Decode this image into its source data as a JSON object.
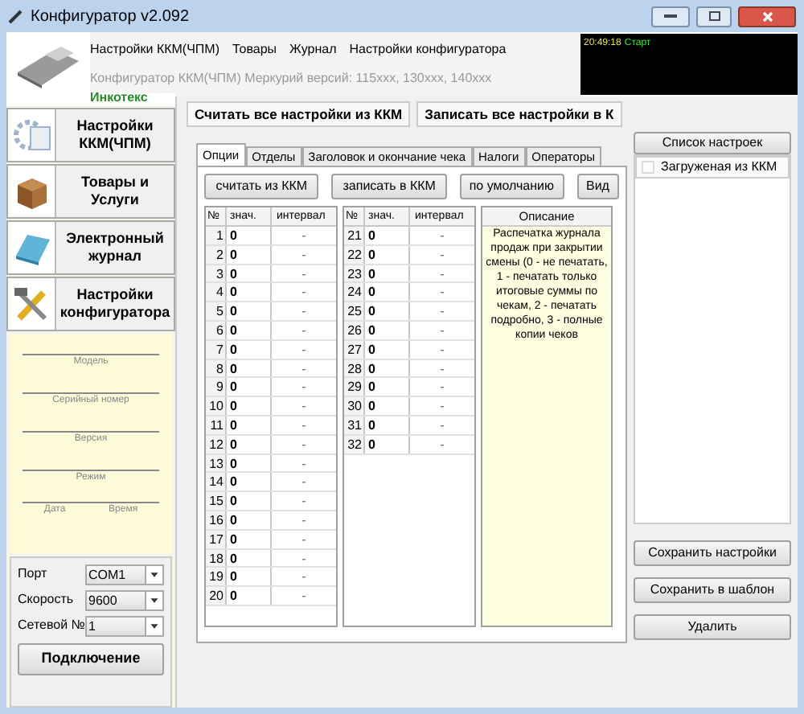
{
  "window": {
    "title": "Конфигуратор v2.092"
  },
  "header": {
    "menu": [
      "Настройки ККМ(ЧПМ)",
      "Товары",
      "Журнал",
      "Настройки конфигуратора"
    ],
    "subtitle": "Конфигуратор ККМ(ЧПМ) Меркурий версий: 115ххх, 130ххх, 140ххх",
    "brand": "Инкотекс",
    "log": [
      {
        "time": "20:49:18",
        "text": "Старт"
      }
    ]
  },
  "sidebar": {
    "nav": [
      {
        "label": "Настройки ККМ(ЧПМ)",
        "kind": "settings"
      },
      {
        "label": "Товары и Услуги",
        "kind": "goods"
      },
      {
        "label": "Электронный журнал",
        "kind": "journal"
      },
      {
        "label": "Настройки конфигуратора",
        "kind": "config"
      }
    ],
    "info_fields": [
      "Модель",
      "Серийный номер",
      "Версия",
      "Режим"
    ],
    "date_label": "Дата",
    "time_label": "Время",
    "connection": {
      "fields": [
        {
          "label": "Порт",
          "value": "COM1"
        },
        {
          "label": "Скорость",
          "value": "9600"
        },
        {
          "label": "Сетевой №",
          "value": "1"
        }
      ],
      "button": "Подключение"
    }
  },
  "toolbar": [
    "Считать все настройки из ККМ",
    "Записать все настройки в К"
  ],
  "tabs": [
    {
      "label": "Опции",
      "selected": true
    },
    {
      "label": "Отделы",
      "selected": false
    },
    {
      "label": "Заголовок и окончание чека",
      "selected": false
    },
    {
      "label": "Налоги",
      "selected": false
    },
    {
      "label": "Операторы",
      "selected": false
    }
  ],
  "actions": [
    "считать из ККМ",
    "записать в ККМ",
    "по умолчанию",
    "Вид"
  ],
  "table": {
    "columns_left": [
      "№",
      "знач.",
      "интервал"
    ],
    "columns_right": [
      "№",
      "знач.",
      "интервал"
    ],
    "rows_left": [
      {
        "n": "1",
        "value": "0",
        "interval": "-"
      },
      {
        "n": "2",
        "value": "0",
        "interval": "-"
      },
      {
        "n": "3",
        "value": "0",
        "interval": "-"
      },
      {
        "n": "4",
        "value": "0",
        "interval": "-"
      },
      {
        "n": "5",
        "value": "0",
        "interval": "-"
      },
      {
        "n": "6",
        "value": "0",
        "interval": "-"
      },
      {
        "n": "7",
        "value": "0",
        "interval": "-"
      },
      {
        "n": "8",
        "value": "0",
        "interval": "-"
      },
      {
        "n": "9",
        "value": "0",
        "interval": "-"
      },
      {
        "n": "10",
        "value": "0",
        "interval": "-"
      },
      {
        "n": "11",
        "value": "0",
        "interval": "-"
      },
      {
        "n": "12",
        "value": "0",
        "interval": "-"
      },
      {
        "n": "13",
        "value": "0",
        "interval": "-"
      },
      {
        "n": "14",
        "value": "0",
        "interval": "-"
      },
      {
        "n": "15",
        "value": "0",
        "interval": "-"
      },
      {
        "n": "16",
        "value": "0",
        "interval": "-"
      },
      {
        "n": "17",
        "value": "0",
        "interval": "-"
      },
      {
        "n": "18",
        "value": "0",
        "interval": "-"
      },
      {
        "n": "19",
        "value": "0",
        "interval": "-"
      },
      {
        "n": "20",
        "value": "0",
        "interval": "-"
      }
    ],
    "rows_right": [
      {
        "n": "21",
        "value": "0",
        "interval": "-"
      },
      {
        "n": "22",
        "value": "0",
        "interval": "-"
      },
      {
        "n": "23",
        "value": "0",
        "interval": "-"
      },
      {
        "n": "24",
        "value": "0",
        "interval": "-"
      },
      {
        "n": "25",
        "value": "0",
        "interval": "-"
      },
      {
        "n": "26",
        "value": "0",
        "interval": "-"
      },
      {
        "n": "27",
        "value": "0",
        "interval": "-"
      },
      {
        "n": "28",
        "value": "0",
        "interval": "-"
      },
      {
        "n": "29",
        "value": "0",
        "interval": "-"
      },
      {
        "n": "30",
        "value": "0",
        "interval": "-"
      },
      {
        "n": "31",
        "value": "0",
        "interval": "-"
      },
      {
        "n": "32",
        "value": "0",
        "interval": "-"
      }
    ]
  },
  "description": {
    "title": "Описание",
    "text": "Распечатка журнала продаж при закрытии смены (0 - не печатать, 1 - печатать только итоговые суммы по чекам, 2 - печатать подробно, 3 - полные копии чеков"
  },
  "settings_list": {
    "button": "Список настроек",
    "items": [
      {
        "label": "Загруженая из ККМ",
        "checked": false
      }
    ]
  },
  "side_buttons": [
    "Сохранить настройки",
    "Сохранить в шаблон",
    "Удалить"
  ]
}
